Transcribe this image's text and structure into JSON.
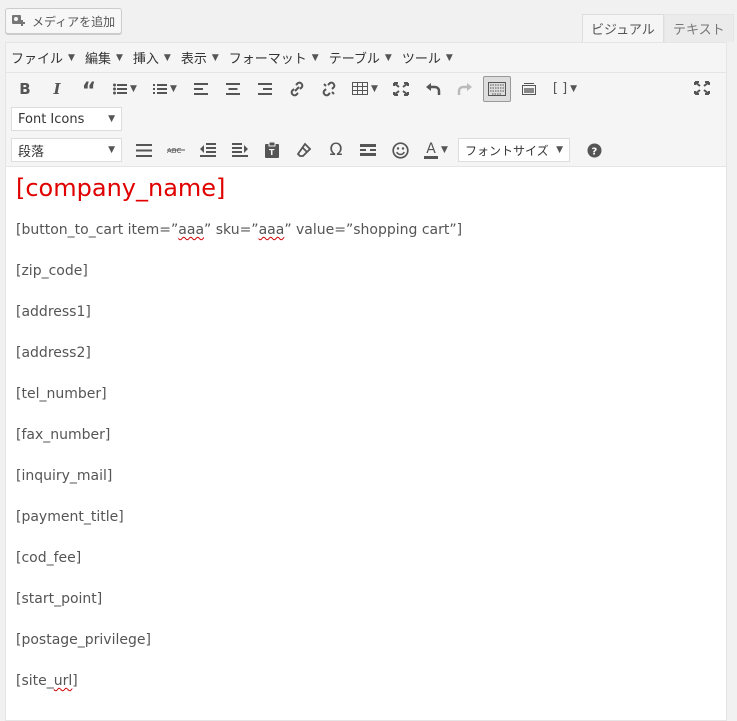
{
  "media_button": {
    "label": "メディアを追加",
    "icon": "media-icon"
  },
  "tabs": [
    {
      "label": "ビジュアル"
    },
    {
      "label": "テキスト"
    }
  ],
  "menubar": [
    {
      "label": "ファイル"
    },
    {
      "label": "編集"
    },
    {
      "label": "挿入"
    },
    {
      "label": "表示"
    },
    {
      "label": "フォーマット"
    },
    {
      "label": "テーブル"
    },
    {
      "label": "ツール"
    }
  ],
  "toolbar": {
    "font_icons": "Font Icons",
    "paragraph": "段落",
    "font_size": "フォントサイズ",
    "shortcode_label": "[ ]"
  },
  "content": {
    "heading": "[company_name]",
    "cart_line": {
      "prefix": "[button_to_cart item=”",
      "item": "aaa",
      "mid1": "” sku=”",
      "sku": "aaa",
      "mid2": "” value=”shopping cart”]"
    },
    "lines": [
      "[zip_code]",
      "[address1]",
      "[address2]",
      "[tel_number]",
      "[fax_number]",
      "[inquiry_mail]",
      "[payment_title]",
      "[cod_fee]",
      "[start_point]",
      "[postage_privilege]"
    ],
    "site_url": {
      "prefix": "[site_",
      "underlined": "url",
      "suffix": "]"
    }
  },
  "colors": {
    "heading": "#e00000",
    "text": "#555555",
    "spellcheck": "#cc0000"
  }
}
